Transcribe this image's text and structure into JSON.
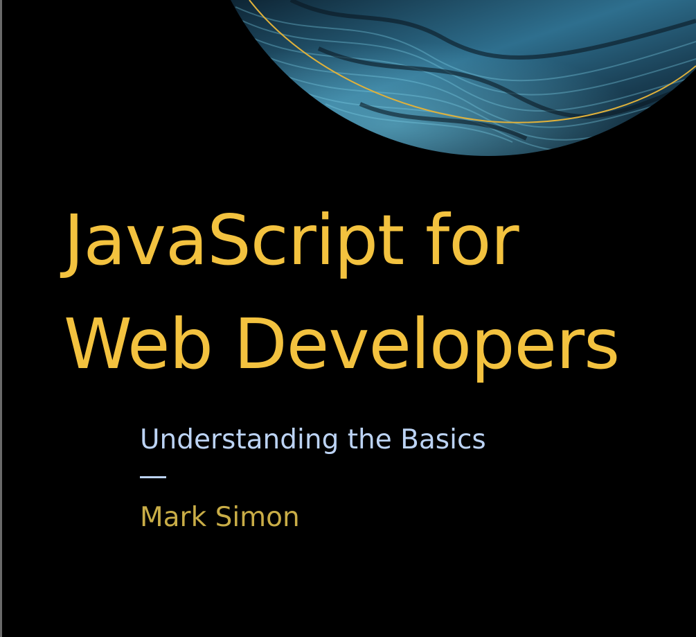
{
  "cover": {
    "title_line1": "JavaScript for",
    "title_line2": "Web Developers",
    "subtitle": "Understanding the Basics",
    "author": "Mark Simon"
  },
  "colors": {
    "background": "#000000",
    "title": "#f3c23f",
    "subtitle": "#bcd3f4",
    "author": "#c9ad47",
    "arc_line": "#e0b13a",
    "art_wave": "#2e6f8e"
  },
  "icons": {
    "art": "abstract-wave-sphere"
  }
}
